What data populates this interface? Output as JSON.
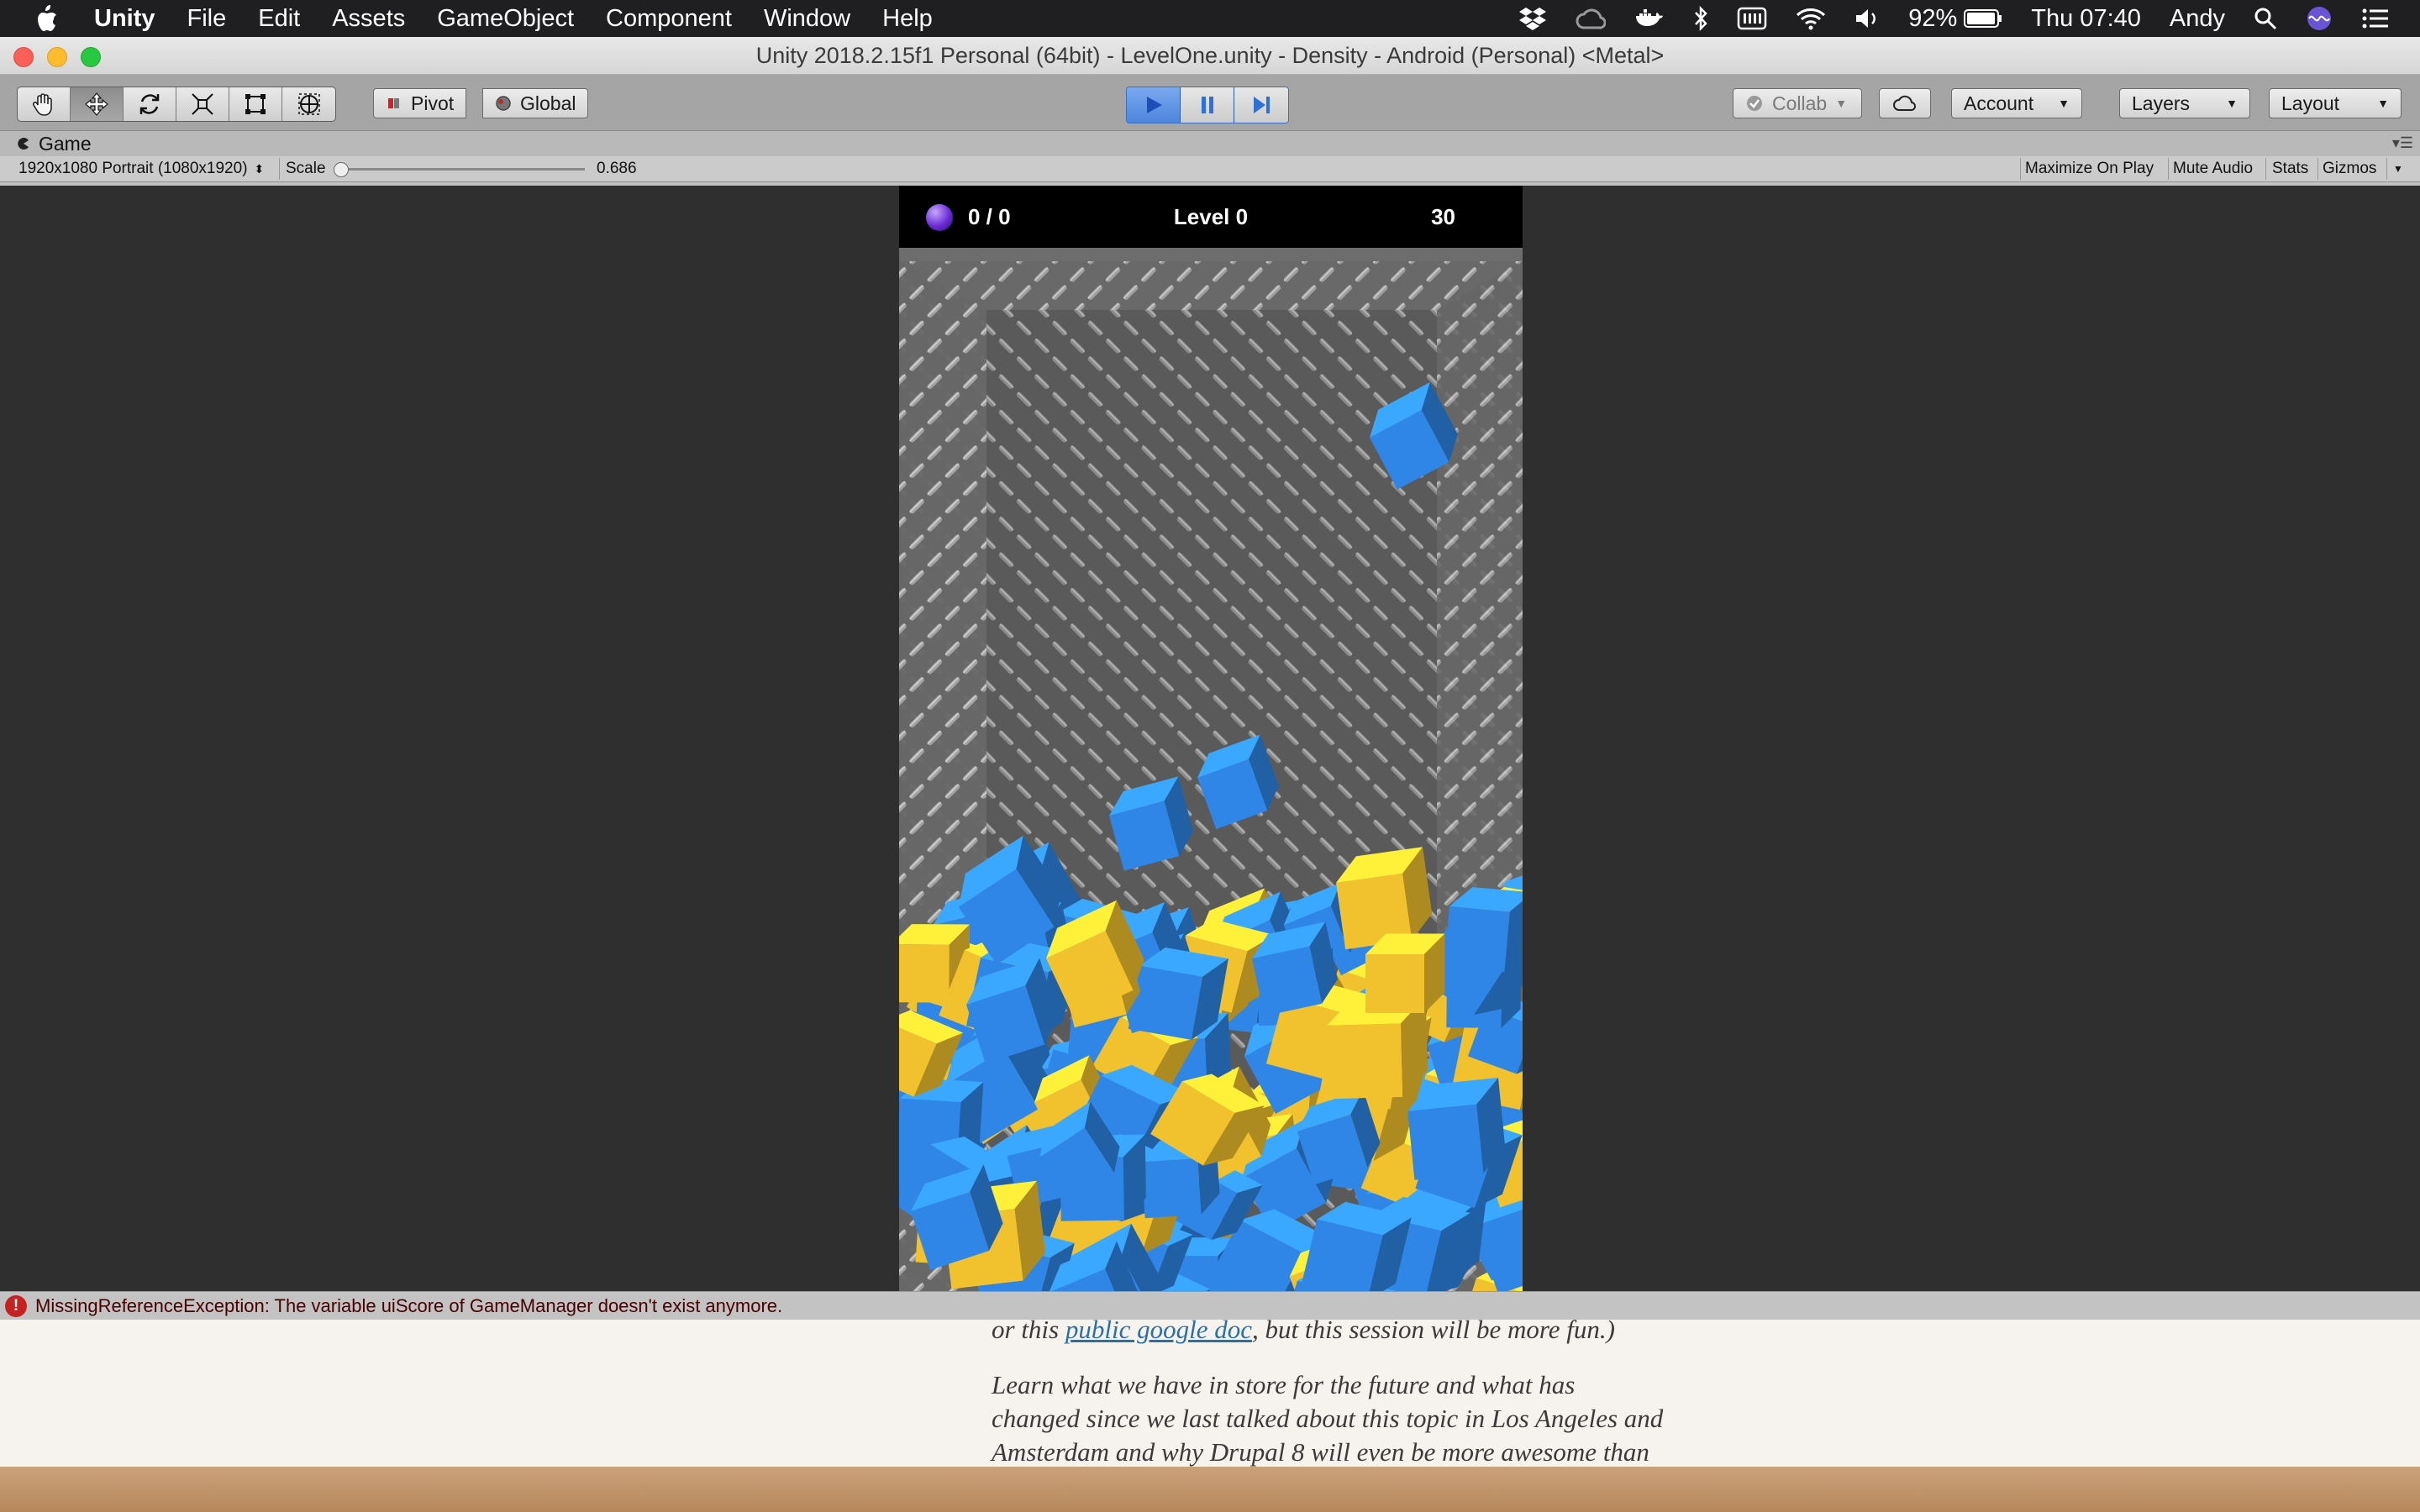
{
  "menubar": {
    "app_name": "Unity",
    "items": [
      "File",
      "Edit",
      "Assets",
      "GameObject",
      "Component",
      "Window",
      "Help"
    ],
    "battery": "92%",
    "clock": "Thu 07:40",
    "user": "Andy"
  },
  "window": {
    "title": "Unity 2018.2.15f1 Personal (64bit) - LevelOne.unity - Density - Android (Personal) <Metal>"
  },
  "toolbar": {
    "pivot_label": "Pivot",
    "global_label": "Global",
    "collab_label": "Collab",
    "account_label": "Account",
    "layers_label": "Layers",
    "layout_label": "Layout"
  },
  "game_tab": {
    "label": "Game",
    "resolution": "1920x1080 Portrait (1080x1920)",
    "scale_label": "Scale",
    "scale_value": "0.686",
    "scale_fraction": 0.0,
    "maximize_on_play": "Maximize On Play",
    "mute_audio": "Mute Audio",
    "stats": "Stats",
    "gizmos": "Gizmos"
  },
  "hud": {
    "score": "0 / 0",
    "level": "Level 0",
    "timer": "30"
  },
  "console": {
    "message": "MissingReferenceException: The variable uiScore of GameManager doesn't exist anymore."
  },
  "browser": {
    "line1_prefix": "or this ",
    "line1_link": "public google doc",
    "line1_suffix": ", but this session will be more fun.)",
    "line2": "Learn what we have in store for the future and what has",
    "line3": "changed since we last talked about this topic in Los Angeles and",
    "line4": "Amsterdam and why Drupal 8 will even be more awesome than"
  },
  "colors": {
    "cube_blue": "#2f86e6",
    "cube_yellow": "#f2c12e",
    "play_accent": "#4d86dd",
    "error_red": "#c62222"
  }
}
